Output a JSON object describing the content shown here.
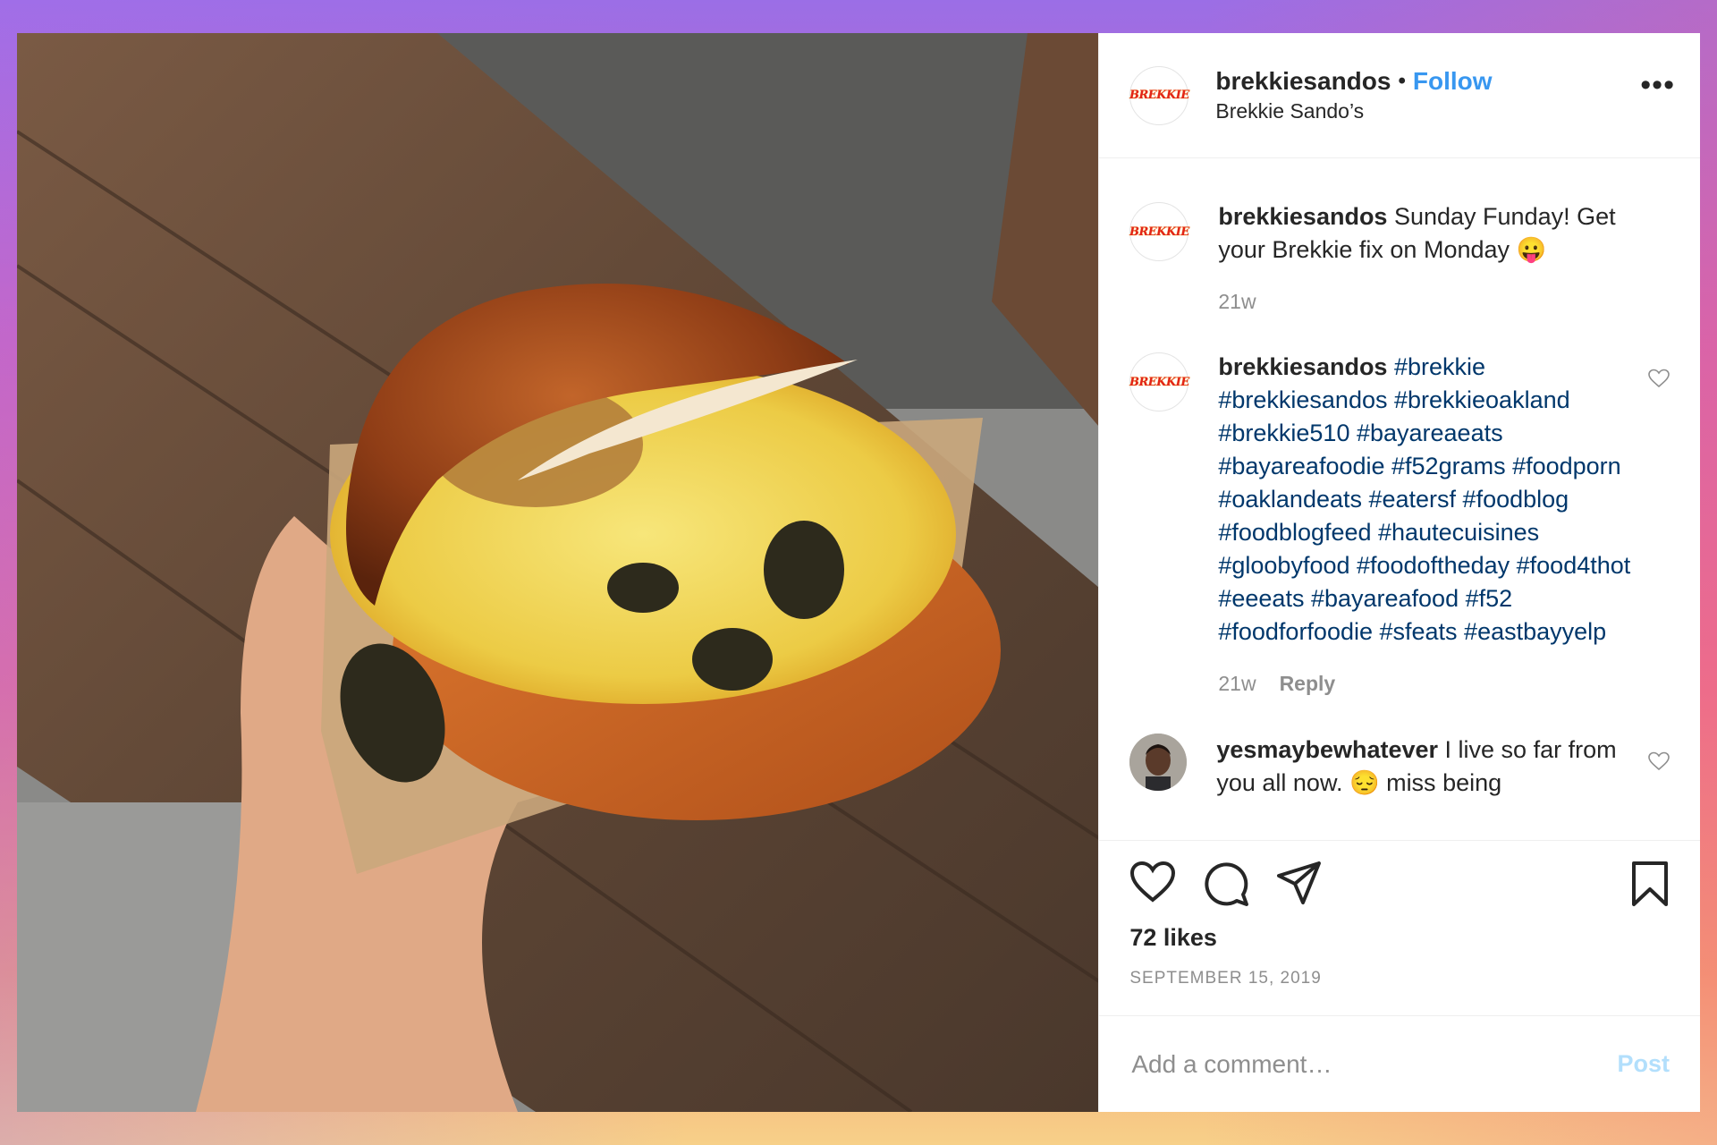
{
  "post": {
    "username": "brekkiesandos",
    "display_name": "Brekkie Sando’s",
    "follow_label": "Follow",
    "dot": "•",
    "more_label": "•••",
    "logo_text": "BREKKIE"
  },
  "comments": [
    {
      "username": "brekkiesandos",
      "text": "Sunday Funday! Get your Brekkie fix on Monday 😛",
      "time": "21w"
    },
    {
      "username": "brekkiesandos",
      "text": "#brekkie #brekkiesandos #brekkieoakland #brekkie510 #bayareaeats #bayareafoodie #f52grams #foodporn #oaklandeats #eatersf #foodblog #foodblogfeed #hautecuisines #gloobyfood #foodoftheday #food4thot #eeeats #bayareafood #f52 #foodforfoodie #sfeats #eastbayyelp",
      "time": "21w",
      "reply_label": "Reply"
    },
    {
      "username": "yesmaybewhatever",
      "text": "I live so far from you all now. 😔 miss being"
    }
  ],
  "actions": {
    "likes": "72 likes",
    "date": "SEPTEMBER 15, 2019"
  },
  "composer": {
    "placeholder": "Add a comment…",
    "post_label": "Post"
  },
  "colors": {
    "accent": "#3897f0",
    "hashtag": "#00376b",
    "muted": "#8e8e8e",
    "post_disabled": "#b2dffc"
  }
}
